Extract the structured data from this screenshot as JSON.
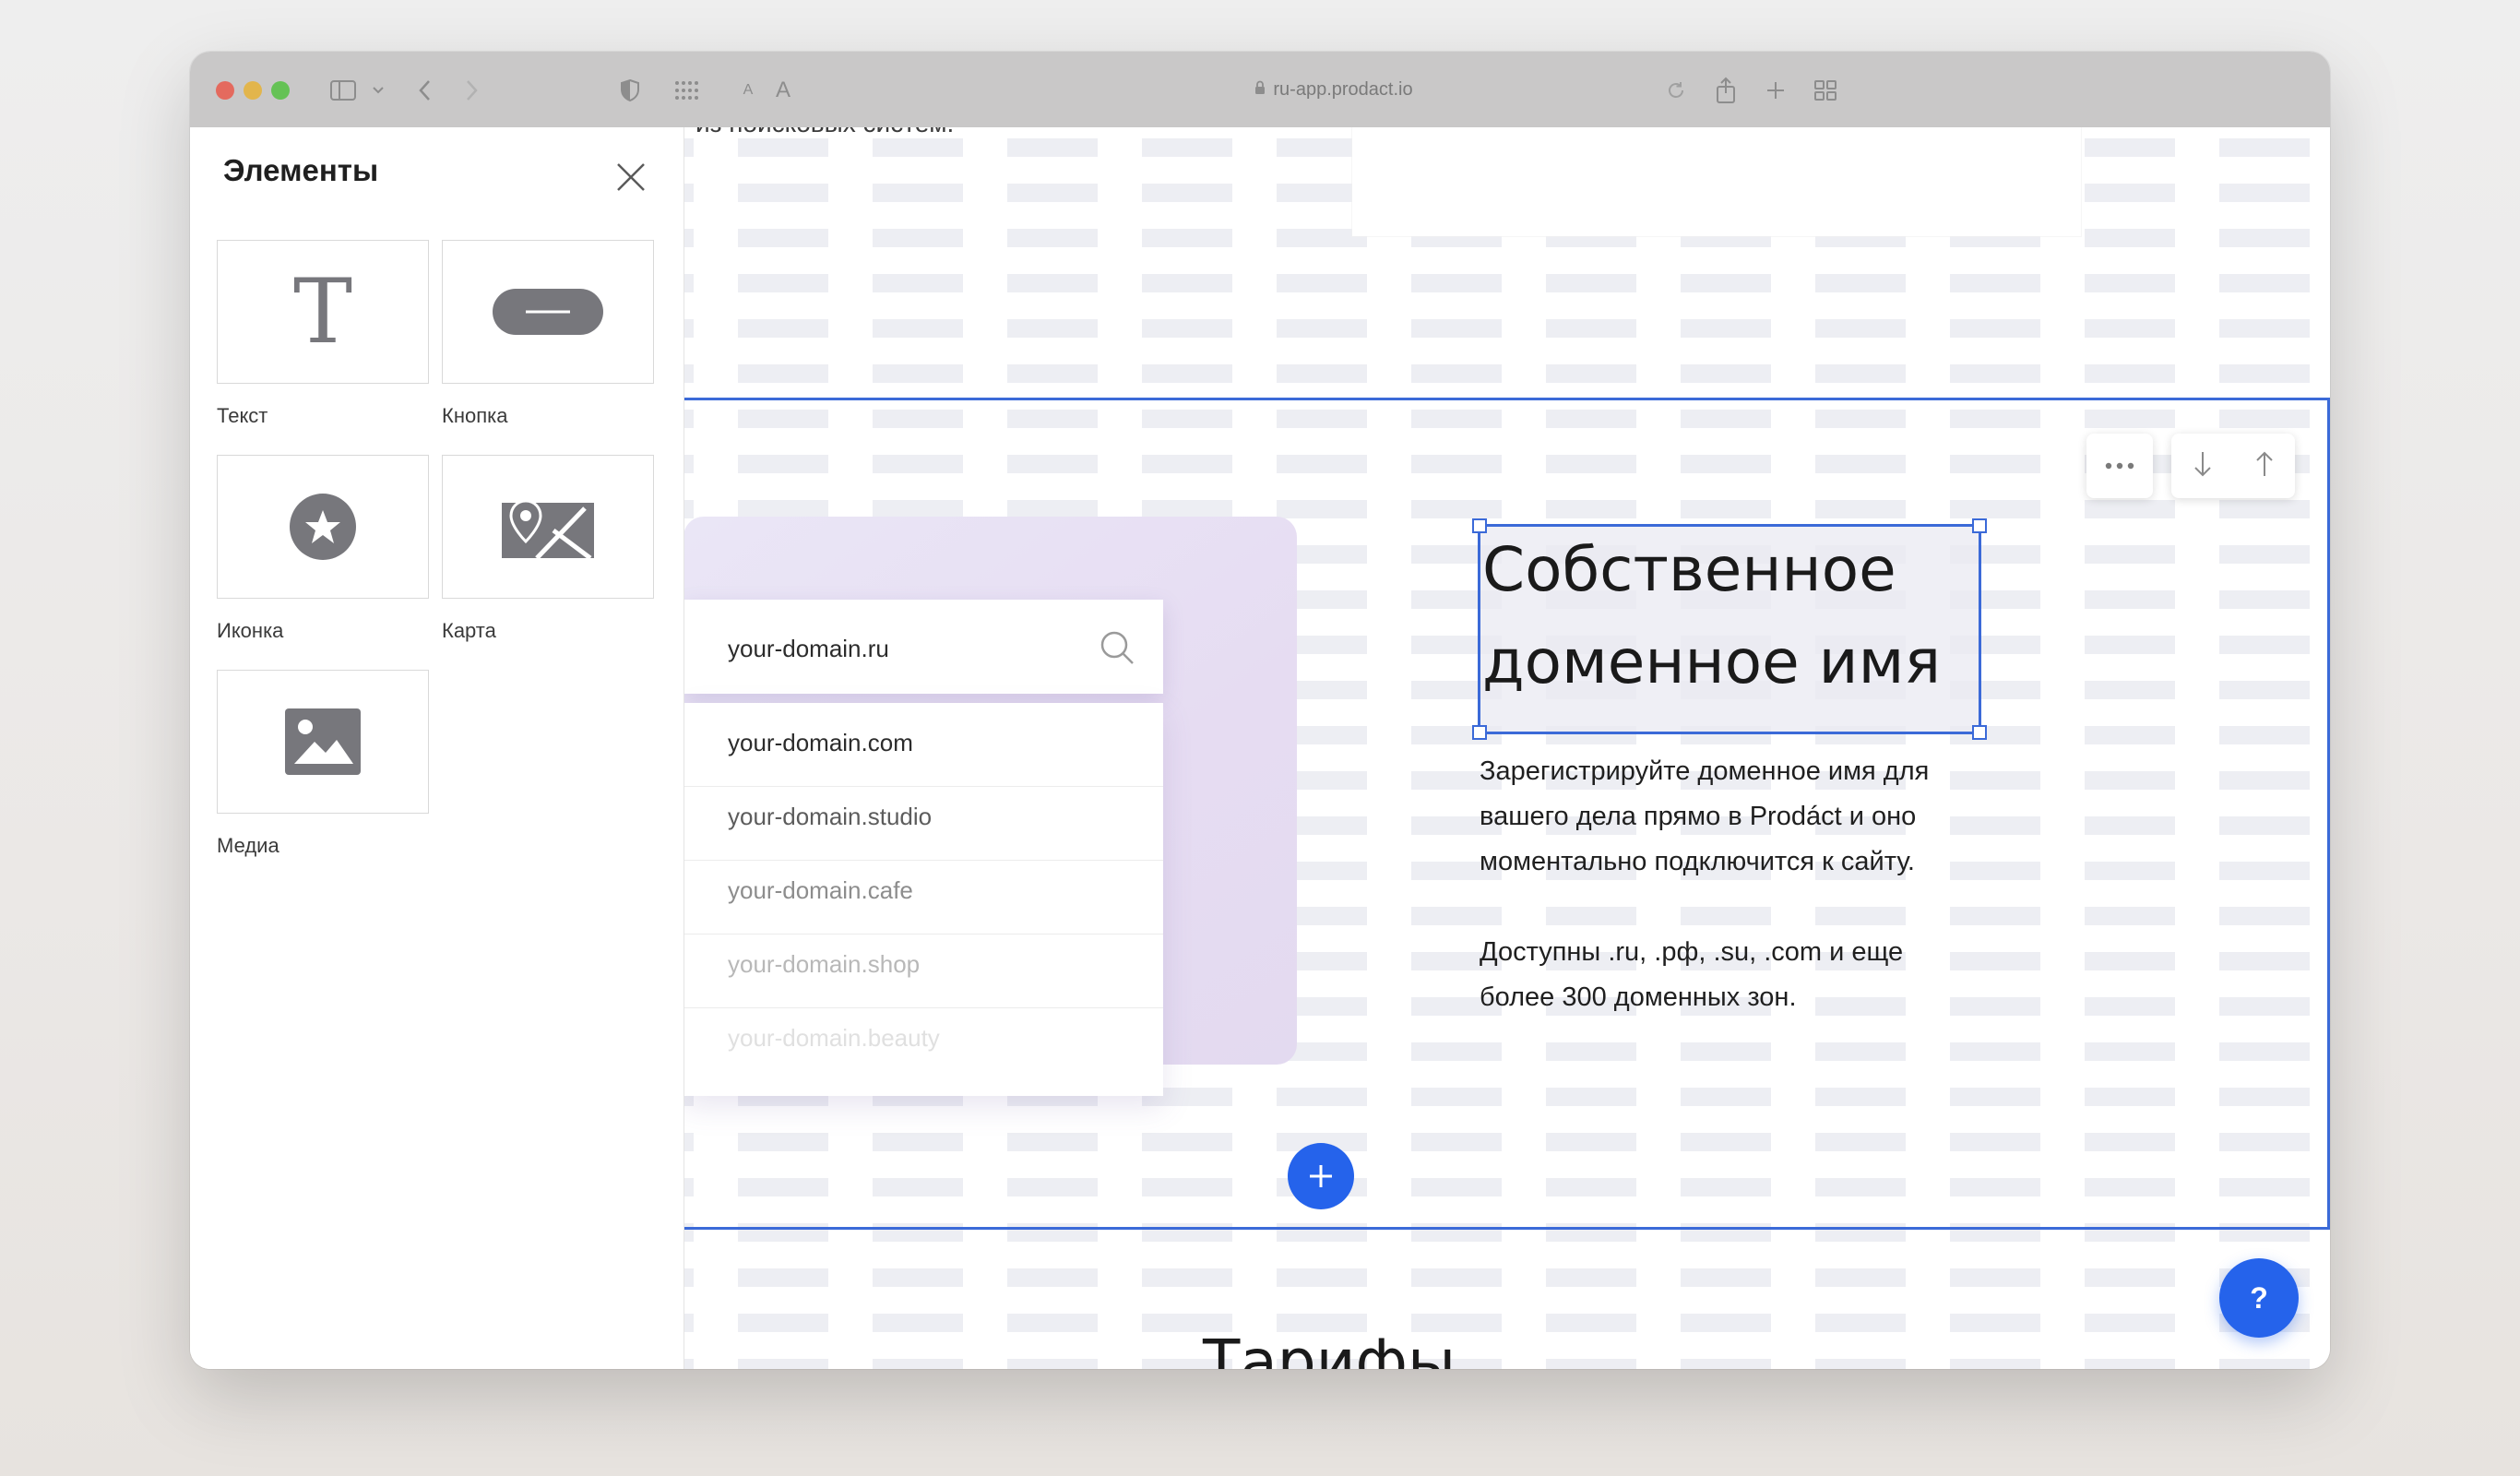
{
  "browser": {
    "url": "ru-app.prodact.io",
    "font_small_label": "A",
    "font_large_label": "A"
  },
  "panel": {
    "title": "Элементы",
    "elements": [
      {
        "label": "Текст",
        "icon": "text-T-icon"
      },
      {
        "label": "Кнопка",
        "icon": "button-pill-icon"
      },
      {
        "label": "Иконка",
        "icon": "star-circle-icon"
      },
      {
        "label": "Карта",
        "icon": "map-icon"
      },
      {
        "label": "Медиа",
        "icon": "image-icon"
      }
    ]
  },
  "page": {
    "top_cut_text": "из поисковых систем.",
    "search_value": "your-domain.ru",
    "domain_suggestions": [
      "your-domain.com",
      "your-domain.studio",
      "your-domain.cafe",
      "your-domain.shop",
      "your-domain.beauty"
    ],
    "heading_lines": [
      "Собственное",
      "доменное имя"
    ],
    "paragraph1_lines": [
      "Зарегистрируйте доменное имя для",
      "вашего дела прямо в Prodáct и оно",
      "моментально подключится к сайту."
    ],
    "paragraph2_lines": [
      "Доступны .ru, .рф, .su, .com и еще",
      "более 300 доменных зон."
    ],
    "next_section_title": "Тарифы",
    "help_label": "?"
  },
  "colors": {
    "accent": "#2563eb",
    "selection": "#3b6ad8",
    "titlebar": "#c9c8c8"
  }
}
